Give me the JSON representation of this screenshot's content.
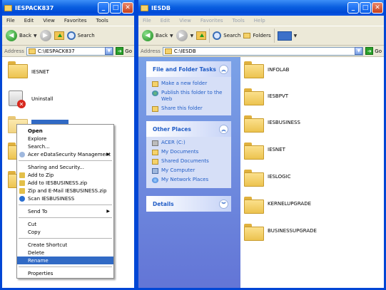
{
  "left_window": {
    "title": "IESPACK837",
    "menu": [
      "File",
      "Edit",
      "View",
      "Favorites",
      "Tools"
    ],
    "toolbar": {
      "back": "Back",
      "search": "Search"
    },
    "address_label": "Address",
    "address_value": "C:\\IESPACK837",
    "go": "Go",
    "items": [
      {
        "label": "IESNET",
        "icon": "folder-icon"
      },
      {
        "label": "Uninstall",
        "icon": "uninstall-icon"
      }
    ]
  },
  "right_window": {
    "title": "IESDB",
    "menu": [
      "File",
      "Edit",
      "View",
      "Favorites",
      "Tools",
      "Help"
    ],
    "toolbar": {
      "back": "Back",
      "search": "Search",
      "folders": "Folders"
    },
    "address_label": "Address",
    "address_value": "C:\\IESDB",
    "go": "Go",
    "tasks": {
      "title": "File and Folder Tasks",
      "items": [
        "Make a new folder",
        "Publish this folder to the Web",
        "Share this folder"
      ]
    },
    "places": {
      "title": "Other Places",
      "items": [
        "ACER (C:)",
        "My Documents",
        "Shared Documents",
        "My Computer",
        "My Network Places"
      ]
    },
    "details": {
      "title": "Details"
    },
    "folders": [
      "INFOLAB",
      "IESBPVT",
      "IESBUSINESS",
      "IESNET",
      "IESLOGIC",
      "KERNELUPGRADE",
      "BUSINESSUPGRADE"
    ]
  },
  "context_menu": {
    "open": "Open",
    "explore": "Explore",
    "search": "Search...",
    "acer": "Acer eDataSecurity Management",
    "sharing": "Sharing and Security...",
    "add_zip": "Add to Zip",
    "add_named_zip": "Add to IESBUSINESS.zip",
    "zip_email": "Zip and E-Mail IESBUSINESS.zip",
    "scan": "Scan IESBUSINESS",
    "send_to": "Send To",
    "cut": "Cut",
    "copy": "Copy",
    "create_shortcut": "Create Shortcut",
    "delete": "Delete",
    "rename": "Rename",
    "properties": "Properties"
  },
  "colors": {
    "title_bar": "#0a5fe0",
    "selection": "#316ac5",
    "side_panel": "#7ba2e7"
  }
}
